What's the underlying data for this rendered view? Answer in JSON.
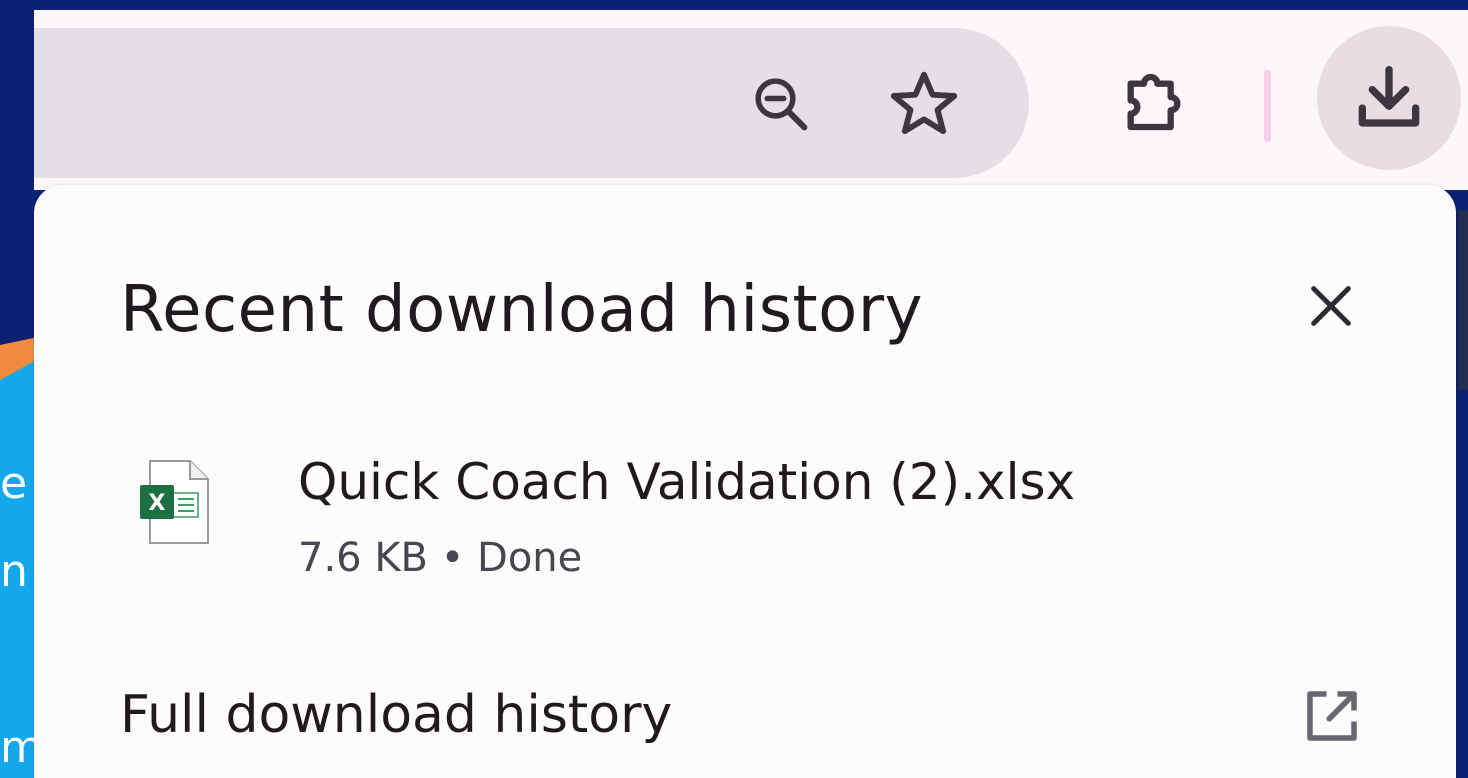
{
  "toolbar": {
    "icons": {
      "zoom": "zoom-out-icon",
      "bookmark": "star-icon",
      "extensions": "puzzle-piece-icon",
      "downloads": "download-icon"
    }
  },
  "background": {
    "side_text": "e n m"
  },
  "download_panel": {
    "title": "Recent download history",
    "items": [
      {
        "file_name": "Quick Coach Validation (2).xlsx",
        "status": "7.6 KB • Done",
        "icon": "excel-file-icon"
      }
    ],
    "footer_link": "Full download history",
    "footer_icon": "open-in-new-icon",
    "close_icon": "close-icon"
  },
  "colors": {
    "accent_blue": "#0b2272",
    "excel_green": "#1d7044",
    "panel_bg": "#fefbfd",
    "omnibox_bg": "#e5dee5"
  }
}
